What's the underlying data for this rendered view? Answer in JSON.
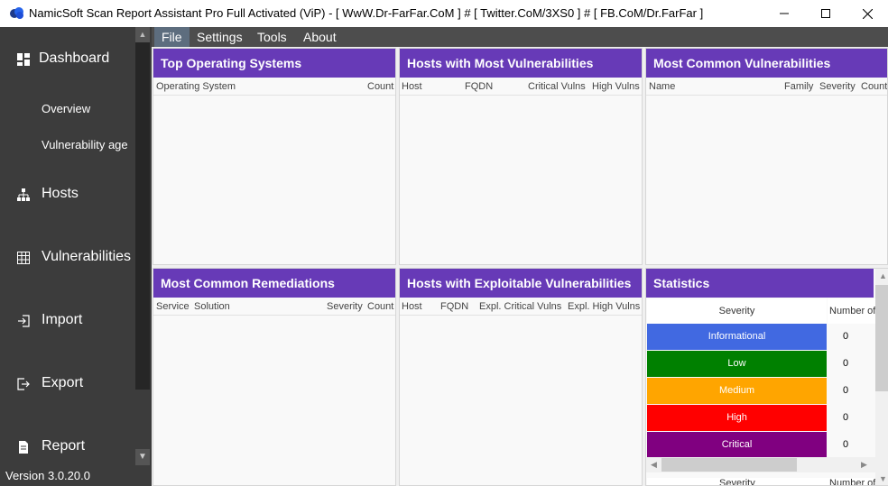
{
  "window": {
    "title": "NamicSoft Scan Report Assistant Pro Full Activated (ViP) - [ WwW.Dr-FarFar.CoM ] # [ Twitter.CoM/3XS0 ] # [ FB.CoM/Dr.FarFar ]"
  },
  "sidebar": {
    "dashboard": "Dashboard",
    "overview": "Overview",
    "vulnerability_age": "Vulnerability age",
    "hosts": "Hosts",
    "vulnerabilities": "Vulnerabilities",
    "import": "Import",
    "export": "Export",
    "report": "Report",
    "version": "Version 3.0.20.0"
  },
  "menu": {
    "file": "File",
    "settings": "Settings",
    "tools": "Tools",
    "about": "About"
  },
  "panels": {
    "top_os": {
      "title": "Top Operating Systems",
      "col_os": "Operating System",
      "col_count": "Count"
    },
    "hosts_most_vulns": {
      "title": "Hosts with Most Vulnerabilities",
      "col_host": "Host",
      "col_fqdn": "FQDN",
      "col_critical": "Critical Vulns",
      "col_high": "High Vulns"
    },
    "most_common_vulns": {
      "title": "Most Common Vulnerabilities",
      "col_name": "Name",
      "col_family": "Family",
      "col_severity": "Severity",
      "col_count": "Count"
    },
    "most_common_remediations": {
      "title": "Most Common Remediations",
      "col_service": "Service",
      "col_solution": "Solution",
      "col_severity": "Severity",
      "col_count": "Count"
    },
    "hosts_exploitable": {
      "title": "Hosts with Exploitable Vulnerabilities",
      "col_host": "Host",
      "col_fqdn": "FQDN",
      "col_expl_critical": "Expl. Critical Vulns",
      "col_expl_high": "Expl. High Vulns"
    },
    "statistics": {
      "title": "Statistics",
      "col_severity": "Severity",
      "col_number": "Number of",
      "rows": [
        {
          "severity": "Informational",
          "number": "0",
          "color": "#4169e1"
        },
        {
          "severity": "Low",
          "number": "0",
          "color": "#008000"
        },
        {
          "severity": "Medium",
          "number": "0",
          "color": "#ffa500"
        },
        {
          "severity": "High",
          "number": "0",
          "color": "#ff0000"
        },
        {
          "severity": "Critical",
          "number": "0",
          "color": "#800080"
        }
      ],
      "second_col_severity": "Severity",
      "second_col_number": "Number of"
    }
  },
  "colors": {
    "panel_header": "#673ab7",
    "sidebar": "#3c3c3c",
    "menubar": "#4d4d4d"
  }
}
